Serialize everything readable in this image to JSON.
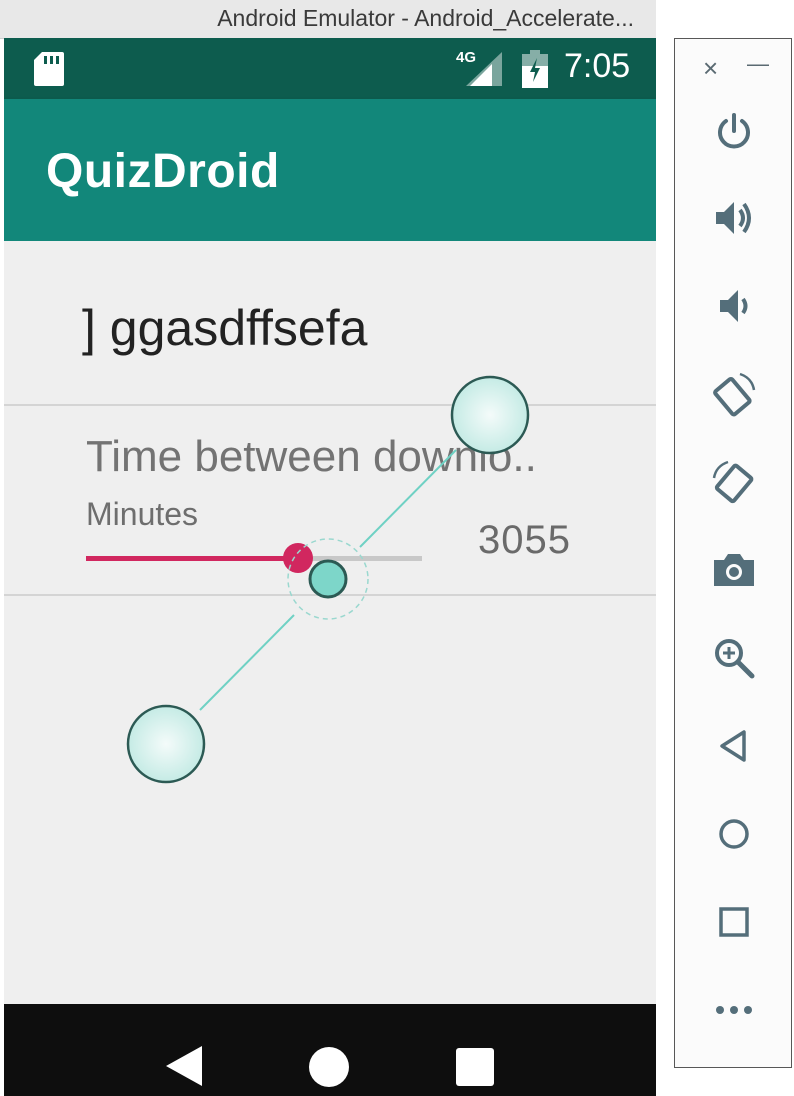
{
  "window": {
    "title": "Android Emulator - Android_Accelerate..."
  },
  "status_bar": {
    "network": "4G",
    "time": "7:05",
    "icons": [
      "sd-card-icon",
      "signal-icon",
      "battery-icon"
    ]
  },
  "app_bar": {
    "title": "QuizDroid"
  },
  "preferences": {
    "title_text": "] ggasdffsefa",
    "time_setting": {
      "label": "Time between downlo..",
      "summary": "Minutes",
      "value": "3055",
      "slider_fraction": 0.63
    }
  },
  "nav_bar": {
    "icons": [
      "back-icon",
      "home-icon",
      "recents-icon"
    ]
  },
  "emulator_panel": {
    "close_glyph": "×",
    "minimize_glyph": "—",
    "buttons": [
      "power-icon",
      "volume-up-icon",
      "volume-down-icon",
      "rotate-left-icon",
      "rotate-right-icon",
      "camera-icon",
      "zoom-icon",
      "back-icon",
      "home-icon",
      "overview-icon",
      "more-icon"
    ]
  },
  "colors": {
    "status_bar": "#0d5c4e",
    "app_bar": "#12877a",
    "accent": "#d1275f",
    "touch_overlay": "#7dd6c9"
  }
}
